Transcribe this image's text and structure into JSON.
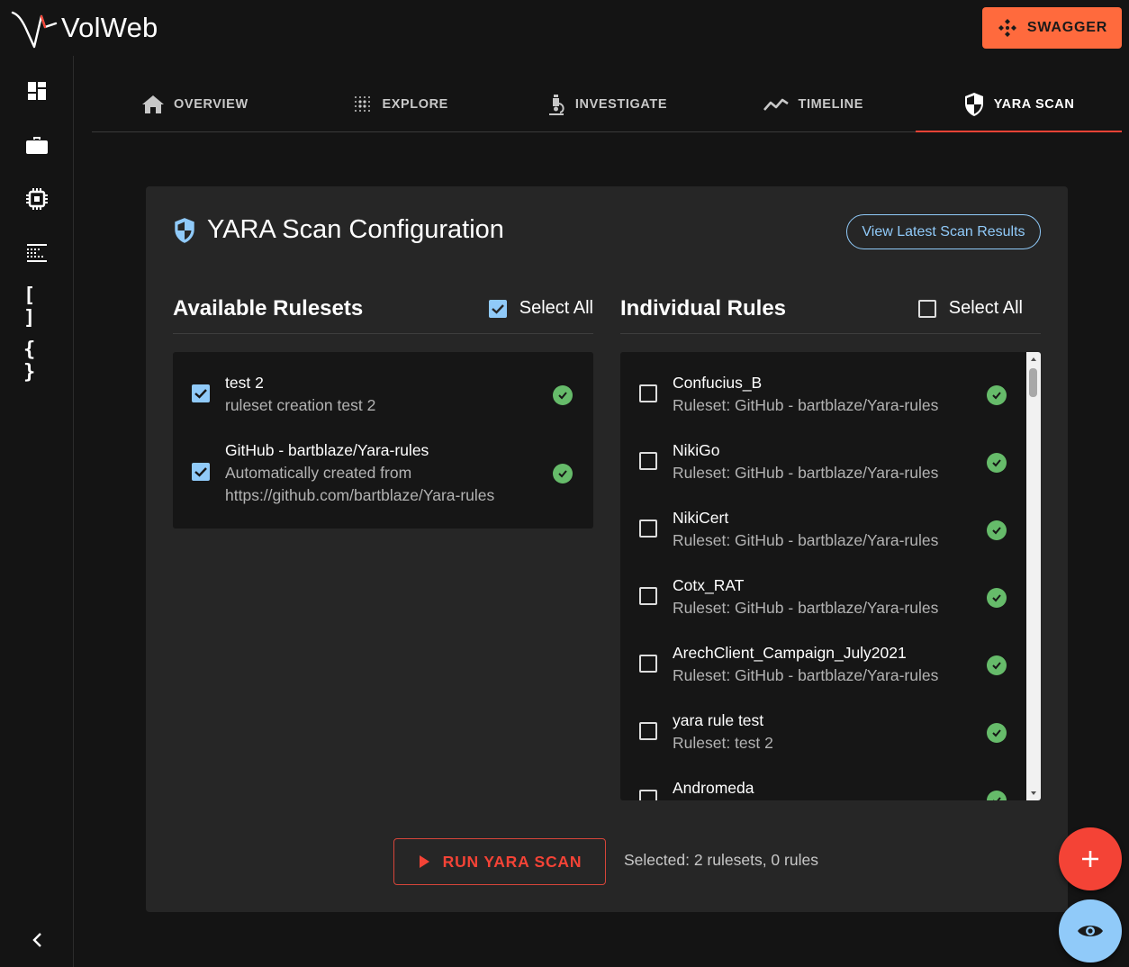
{
  "app": {
    "name": "VolWeb"
  },
  "header": {
    "swagger_label": "SWAGGER"
  },
  "sidebar": {
    "items": [
      {
        "icon": "dashboard-icon"
      },
      {
        "icon": "briefcase-icon"
      },
      {
        "icon": "chip-icon"
      },
      {
        "icon": "list-dots-icon"
      },
      {
        "icon": "brackets-icon",
        "glyph": "[ ]"
      },
      {
        "icon": "braces-icon",
        "glyph": "{ }"
      }
    ],
    "collapse_icon": "chevron-left-icon"
  },
  "tabs": [
    {
      "label": "OVERVIEW",
      "icon": "home-icon",
      "active": false
    },
    {
      "label": "EXPLORE",
      "icon": "dot-grid-icon",
      "active": false
    },
    {
      "label": "INVESTIGATE",
      "icon": "microscope-icon",
      "active": false
    },
    {
      "label": "TIMELINE",
      "icon": "timeline-icon",
      "active": false
    },
    {
      "label": "YARA SCAN",
      "icon": "shield-icon",
      "active": true
    }
  ],
  "config": {
    "title": "YARA Scan Configuration",
    "view_results_label": "View Latest Scan Results",
    "rulesets": {
      "heading": "Available Rulesets",
      "select_all_label": "Select All",
      "select_all_checked": true,
      "items": [
        {
          "name": "test 2",
          "description": "ruleset creation test 2",
          "checked": true
        },
        {
          "name": "GitHub - bartblaze/Yara-rules",
          "description": "Automatically created from",
          "description2": "https://github.com/bartblaze/Yara-rules",
          "checked": true
        }
      ]
    },
    "rules": {
      "heading": "Individual Rules",
      "select_all_label": "Select All",
      "select_all_checked": false,
      "items": [
        {
          "name": "Confucius_B",
          "ruleset": "Ruleset: GitHub - bartblaze/Yara-rules"
        },
        {
          "name": "NikiGo",
          "ruleset": "Ruleset: GitHub - bartblaze/Yara-rules"
        },
        {
          "name": "NikiCert",
          "ruleset": "Ruleset: GitHub - bartblaze/Yara-rules"
        },
        {
          "name": "Cotx_RAT",
          "ruleset": "Ruleset: GitHub - bartblaze/Yara-rules"
        },
        {
          "name": "ArechClient_Campaign_July2021",
          "ruleset": "Ruleset: GitHub - bartblaze/Yara-rules"
        },
        {
          "name": "yara rule test",
          "ruleset": "Ruleset: test 2"
        },
        {
          "name": "Andromeda",
          "ruleset": ""
        }
      ]
    },
    "run_label": "RUN YARA SCAN",
    "status": "Selected: 2 rulesets, 0 rules"
  },
  "colors": {
    "accent": "#f44336",
    "swagger": "#ff6a3d",
    "primary": "#90caf9",
    "success": "#66bb6a"
  }
}
